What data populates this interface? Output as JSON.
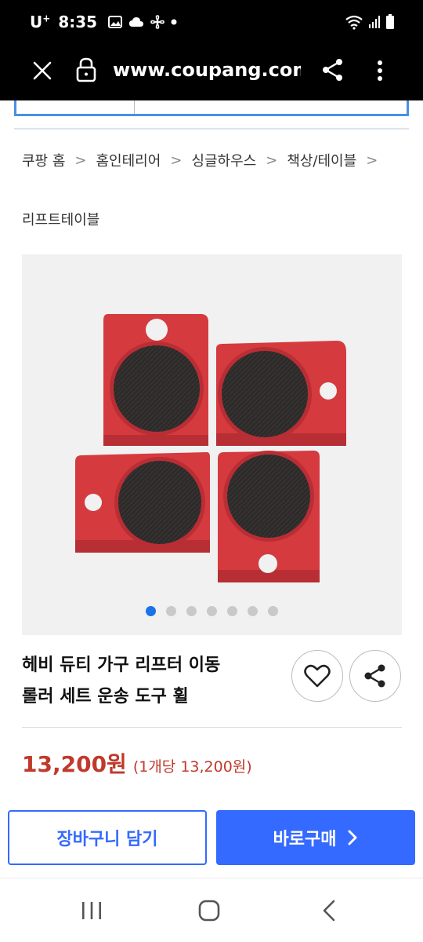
{
  "status_bar": {
    "carrier": "U",
    "carrier_sup": "+",
    "time": "8:35"
  },
  "browser": {
    "url": "www.coupang.com/vp/products"
  },
  "breadcrumb": [
    "쿠팡 홈",
    "홈인테리어",
    "싱글하우스",
    "책상/테이블"
  ],
  "subcategory": "리프트테이블",
  "carousel": {
    "total_dots": 7,
    "active_index": 0
  },
  "product": {
    "title_line1": "헤비 듀티 가구 리프터 이동",
    "title_line2": "롤러 세트 운송 도구 휠",
    "price": "13,200원",
    "unit_price": "(1개당 13,200원)"
  },
  "actions": {
    "cart_label": "장바구니 담기",
    "buy_label": "바로구매"
  },
  "colors": {
    "accent_blue": "#346aff",
    "price_red": "#c0392b",
    "product_red": "#d93a3e"
  }
}
